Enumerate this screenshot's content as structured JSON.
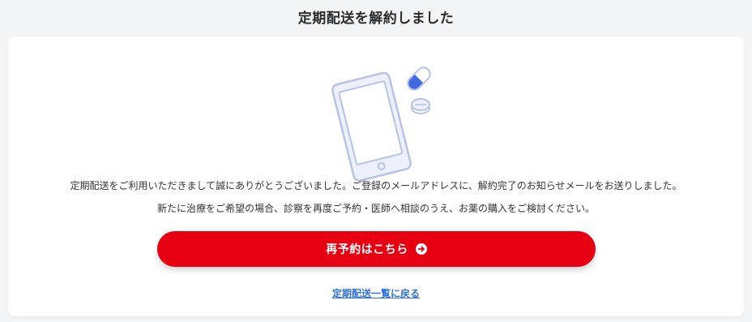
{
  "header": {
    "title": "定期配送を解約しました"
  },
  "card": {
    "illustration_icons": [
      "smartphone-icon",
      "capsule-icon",
      "tablet-pill-icon"
    ],
    "message_line1": "定期配送をご利用いただきまして誠にありがとうございました。ご登録のメールアドレスに、解約完了のお知らせメールをお送りしました。",
    "message_line2": "新たに治療をご希望の場合、診察を再度ご予約・医師へ相談のうえ、お薬の購入をご検討ください。",
    "cta_label": "再予約はこちら",
    "cta_icon": "arrow-right-circle-icon",
    "back_link_label": "定期配送一覧に戻る"
  },
  "colors": {
    "cta": "#e60012",
    "link": "#2f6fdc",
    "background": "#f3f4f6",
    "illustration_stroke": "#b7c2e6",
    "capsule_blue": "#4169e1"
  }
}
